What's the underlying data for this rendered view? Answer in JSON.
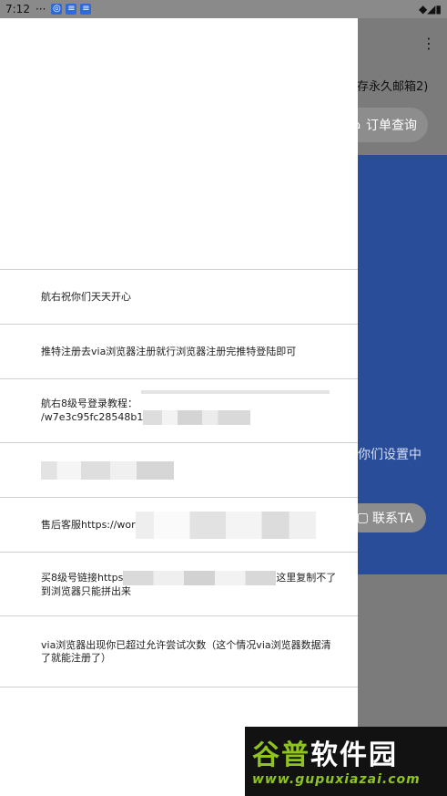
{
  "status_bar": {
    "time": "7:12",
    "dots": "···",
    "right_icons": "◆◢▮"
  },
  "background": {
    "menu_icon": "⋮",
    "subtitle": "存永久邮箱2)",
    "order_button": "订单查询",
    "blue_text": "你们设置中",
    "contact_button": "联系TA",
    "icon_glyph": "⌂"
  },
  "drawer": {
    "items": [
      {
        "line1": "航右祝你们天天开心"
      },
      {
        "line1": "推特注册去via浏览器注册就行浏览器注册完推特登陆即可"
      },
      {
        "line1": "航右8级号登录教程：",
        "line2": "/w7e3c95fc28548b1"
      },
      {
        "line1": ""
      },
      {
        "line1": "售后客服https://wor"
      },
      {
        "line1": "买8级号链接https",
        "line1_tail": "这里复制不了",
        "line2": "到浏览器只能拼出来"
      },
      {
        "line1": "via浏览器出现你已超过允许尝试次数（这个情况via浏览器数据清",
        "line2": "了就能注册了）"
      }
    ]
  },
  "watermark": {
    "logo_a": "谷普",
    "logo_b": "软件园",
    "url": "www.gupuxiazai.com"
  }
}
